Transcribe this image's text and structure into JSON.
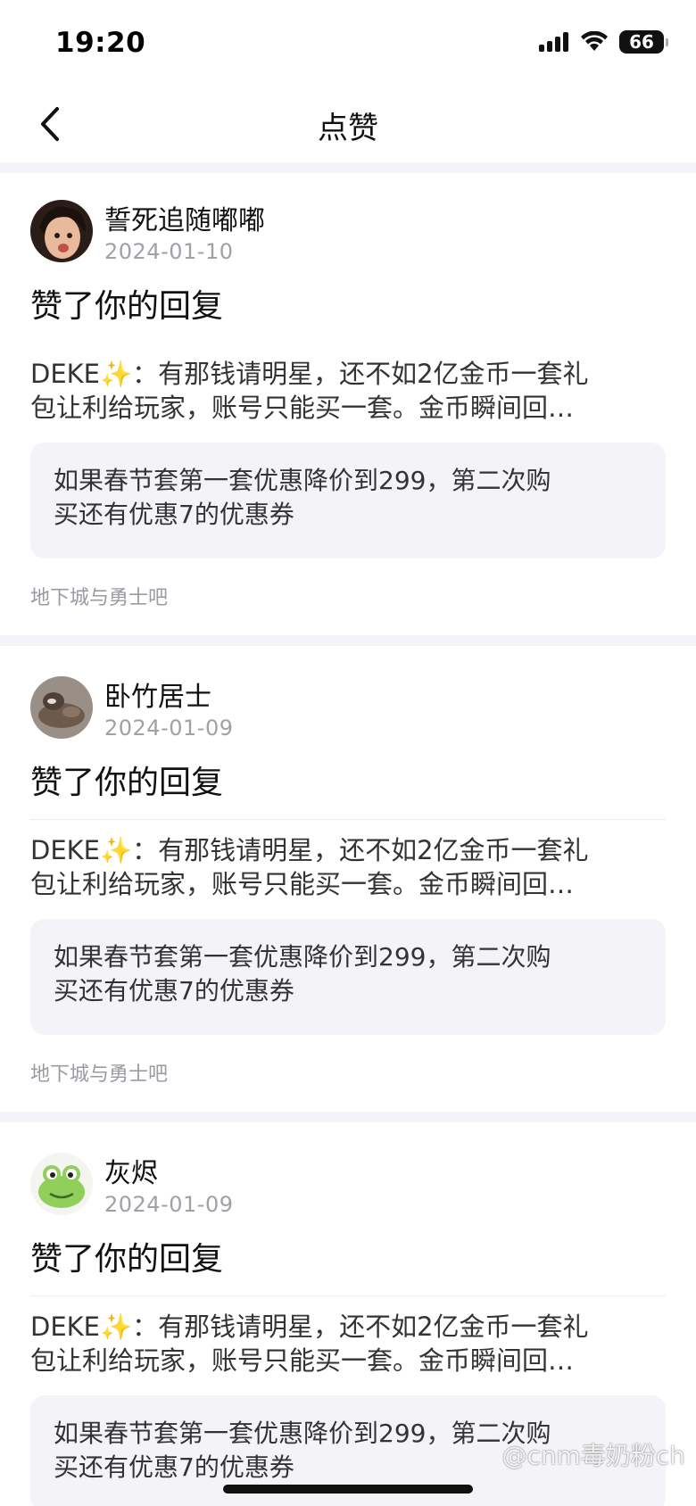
{
  "status_bar": {
    "time": "19:20",
    "battery": "66"
  },
  "nav": {
    "title": "点赞",
    "back_icon": "chevron-left-icon"
  },
  "items": [
    {
      "username": "誓死追随嘟嘟",
      "date": "2024-01-10",
      "action": "赞了你的回复",
      "reply_line1": "DEKE✨：有那钱请明星，还不如2亿金币一套礼",
      "reply_line2": "包让利给玩家，账号只能买一套。金币瞬间回…",
      "quote_line1": "如果春节套第一套优惠降价到299，第二次购",
      "quote_line2": "买还有优惠7的优惠券",
      "forum": "地下城与勇士吧"
    },
    {
      "username": "卧竹居士",
      "date": "2024-01-09",
      "action": "赞了你的回复",
      "reply_line1": "DEKE✨：有那钱请明星，还不如2亿金币一套礼",
      "reply_line2": "包让利给玩家，账号只能买一套。金币瞬间回…",
      "quote_line1": "如果春节套第一套优惠降价到299，第二次购",
      "quote_line2": "买还有优惠7的优惠券",
      "forum": "地下城与勇士吧"
    },
    {
      "username": "灰烬",
      "date": "2024-01-09",
      "action": "赞了你的回复",
      "reply_line1": "DEKE✨：有那钱请明星，还不如2亿金币一套礼",
      "reply_line2": "包让利给玩家，账号只能买一套。金币瞬间回…",
      "quote_line1": "如果春节套第一套优惠降价到299，第二次购",
      "quote_line2": "买还有优惠7的优惠券",
      "forum": ""
    }
  ],
  "watermark": "@cnm毒奶粉ch",
  "colors": {
    "background": "#ffffff",
    "separator": "#f3f4f8",
    "quote_bg": "#f4f4f8",
    "muted_text": "#a0a0a8"
  }
}
